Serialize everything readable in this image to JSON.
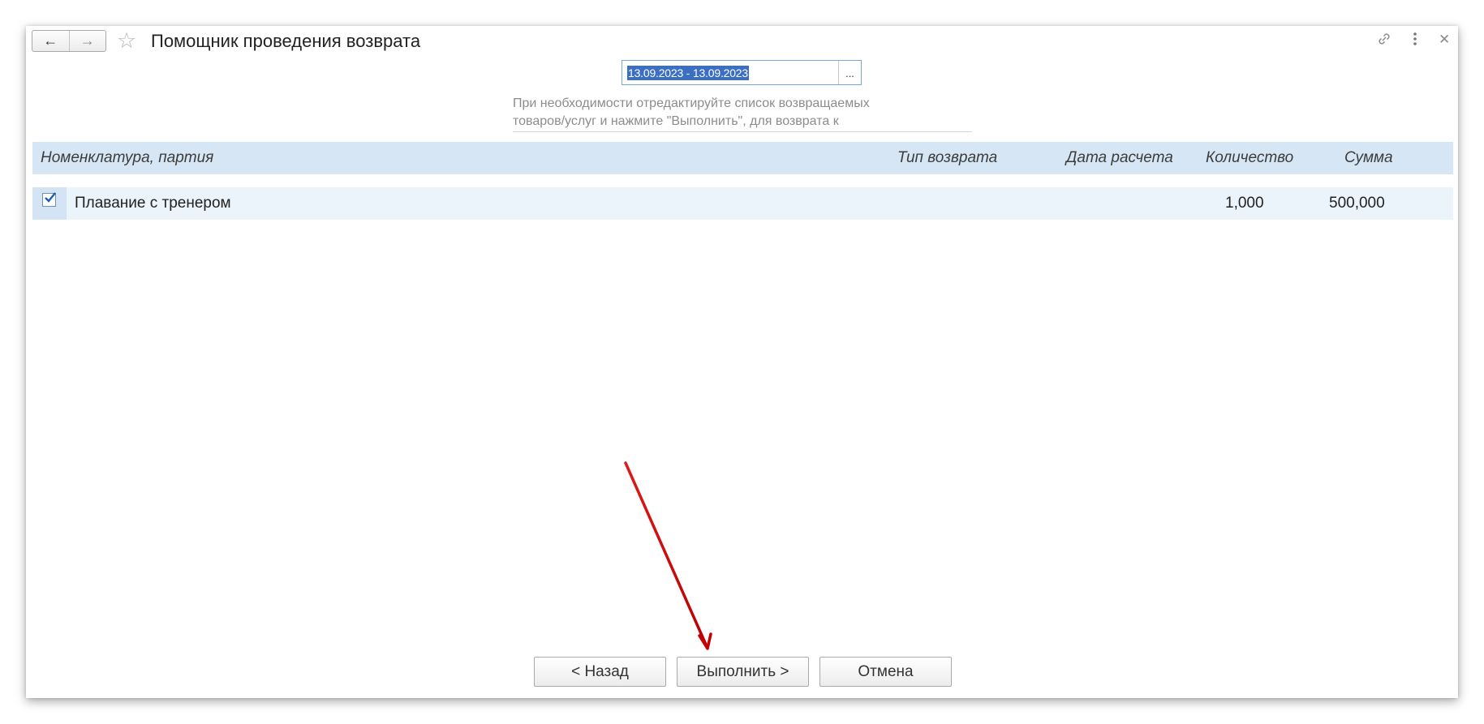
{
  "window": {
    "title": "Помощник проведения возврата",
    "icons": {
      "back": "arrow-left-icon",
      "forward": "arrow-right-icon",
      "favorite": "star-icon",
      "link": "link-icon",
      "more": "more-vertical-icon",
      "close": "close-icon"
    }
  },
  "period": {
    "value": "13.09.2023 - 13.09.2023",
    "select_button": "..."
  },
  "hint": {
    "line1": "При необходимости отредактируйте список возвращаемых",
    "line2": "товаров/услуг и нажмите \"Выполнить\", для возврата к"
  },
  "table": {
    "columns": [
      "Номенклатура, партия",
      "Тип возврата",
      "Дата расчета",
      "Количество",
      "Сумма"
    ],
    "rows": [
      {
        "checked": true,
        "name": "Плавание с тренером",
        "return_type": "",
        "calc_date": "",
        "quantity": "1,000",
        "sum": "500,000"
      }
    ]
  },
  "buttons": {
    "back": "< Назад",
    "execute": "Выполнить >",
    "cancel": "Отмена"
  },
  "colors": {
    "header_bg": "#d6e6f5",
    "row_bg": "#ebf3fb",
    "selection": "#3a6fc4",
    "annotation_arrow": "#d40000"
  }
}
